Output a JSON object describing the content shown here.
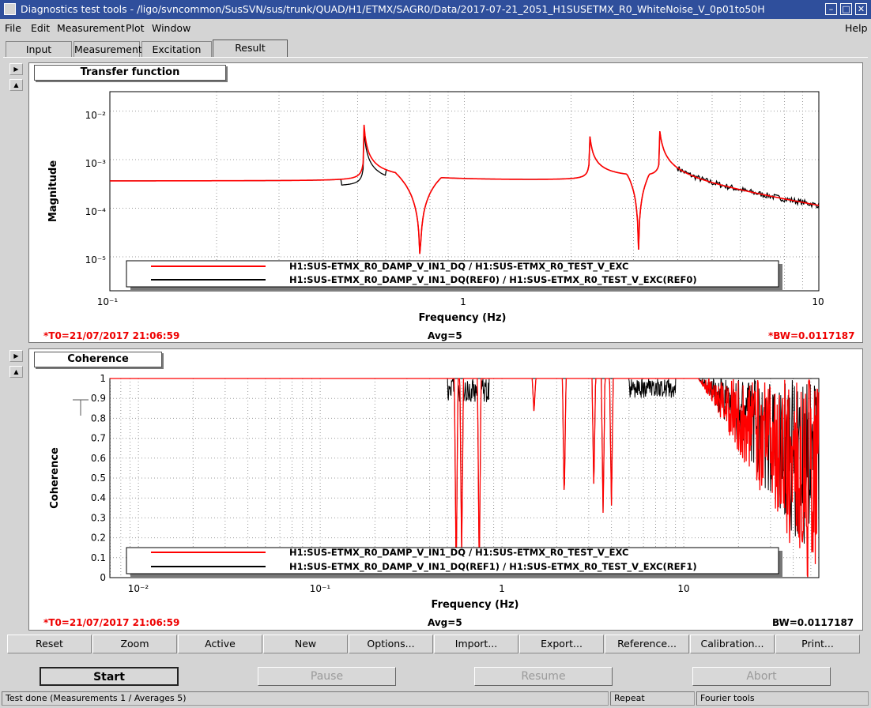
{
  "window": {
    "title": "Diagnostics test tools - /ligo/svncommon/SusSVN/sus/trunk/QUAD/H1/ETMX/SAGR0/Data/2017-07-21_2051_H1SUSETMX_R0_WhiteNoise_V_0p01to50H",
    "minimize_glyph": "–",
    "maximize_glyph": "□",
    "close_glyph": "✕"
  },
  "menu": {
    "file": "File",
    "edit": "Edit",
    "measurement": "Measurement",
    "plot": "Plot",
    "window": "Window",
    "help": "Help"
  },
  "tabs": [
    "Input",
    "Measurement",
    "Excitation",
    "Result"
  ],
  "plot1": {
    "name": "Transfer function",
    "ylabel": "Magnitude",
    "xlabel": "Frequency (Hz)",
    "xticks": [
      "10⁻¹",
      "1",
      "10"
    ],
    "yticks": [
      "10⁻²",
      "10⁻³",
      "10⁻⁴",
      "10⁻⁵"
    ],
    "t0": "*T0=21/07/2017 21:06:59",
    "avg": "Avg=5",
    "bw": "*BW=0.0117187",
    "legend": [
      {
        "label": "H1:SUS-ETMX_R0_DAMP_V_IN1_DQ / H1:SUS-ETMX_R0_TEST_V_EXC",
        "color": "#ff0000"
      },
      {
        "label": "H1:SUS-ETMX_R0_DAMP_V_IN1_DQ(REF0) / H1:SUS-ETMX_R0_TEST_V_EXC(REF0)",
        "color": "#000000"
      }
    ]
  },
  "plot2": {
    "name": "Coherence",
    "ylabel": "Coherence",
    "xlabel": "Frequency (Hz)",
    "xticks": [
      "10⁻²",
      "10⁻¹",
      "1",
      "10"
    ],
    "yticks": [
      "1",
      "0.9",
      "0.8",
      "0.7",
      "0.6",
      "0.5",
      "0.4",
      "0.3",
      "0.2",
      "0.1",
      "0"
    ],
    "t0": "*T0=21/07/2017 21:06:59",
    "avg": "Avg=5",
    "bw": "BW=0.0117187",
    "legend": [
      {
        "label": "H1:SUS-ETMX_R0_DAMP_V_IN1_DQ / H1:SUS-ETMX_R0_TEST_V_EXC",
        "color": "#ff0000"
      },
      {
        "label": "H1:SUS-ETMX_R0_DAMP_V_IN1_DQ(REF1) / H1:SUS-ETMX_R0_TEST_V_EXC(REF1)",
        "color": "#000000"
      }
    ]
  },
  "plot_buttons": [
    "Reset",
    "Zoom",
    "Active",
    "New",
    "Options...",
    "Import...",
    "Export...",
    "Reference...",
    "Calibration...",
    "Print..."
  ],
  "actions": {
    "start": "Start",
    "pause": "Pause",
    "resume": "Resume",
    "abort": "Abort"
  },
  "status": {
    "message": "Test done (Measurements 1 / Averages 5)",
    "mode": "Repeat",
    "type": "Fourier tools"
  },
  "side_buttons": {
    "expand": "▶",
    "collapse": "▲"
  }
}
